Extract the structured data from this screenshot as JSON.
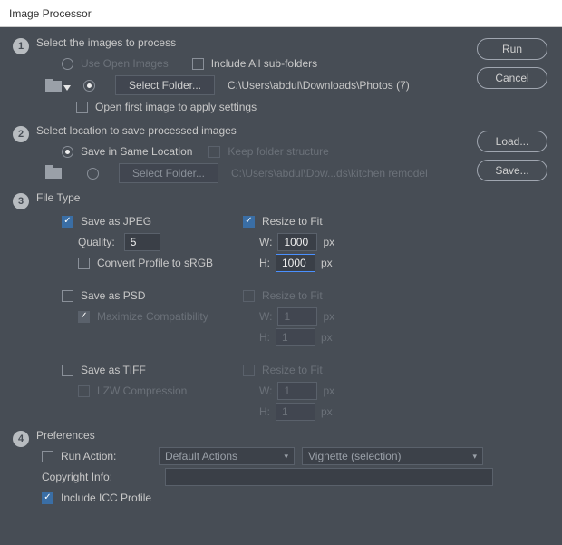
{
  "title": "Image Processor",
  "buttons": {
    "run": "Run",
    "cancel": "Cancel",
    "load": "Load...",
    "save": "Save..."
  },
  "step1": {
    "heading": "Select the images to process",
    "use_open": "Use Open Images",
    "include_sub": "Include All sub-folders",
    "select_folder": "Select Folder...",
    "path": "C:\\Users\\abdul\\Downloads\\Photos (7)",
    "open_first": "Open first image to apply settings"
  },
  "step2": {
    "heading": "Select location to save processed images",
    "same_loc": "Save in Same Location",
    "keep_struct": "Keep folder structure",
    "select_folder": "Select Folder...",
    "path": "C:\\Users\\abdul\\Dow...ds\\kitchen remodel"
  },
  "step3": {
    "heading": "File Type",
    "jpeg": {
      "save": "Save as JPEG",
      "quality_label": "Quality:",
      "quality": "5",
      "convert": "Convert Profile to sRGB",
      "resize": "Resize to Fit",
      "w_label": "W:",
      "w": "1000",
      "h_label": "H:",
      "h": "1000",
      "px": "px"
    },
    "psd": {
      "save": "Save as PSD",
      "max": "Maximize Compatibility",
      "resize": "Resize to Fit",
      "w_label": "W:",
      "w": "1",
      "h_label": "H:",
      "h": "1",
      "px": "px"
    },
    "tiff": {
      "save": "Save as TIFF",
      "lzw": "LZW Compression",
      "resize": "Resize to Fit",
      "w_label": "W:",
      "w": "1",
      "h_label": "H:",
      "h": "1",
      "px": "px"
    }
  },
  "step4": {
    "heading": "Preferences",
    "run_action": "Run Action:",
    "action_set": "Default Actions",
    "action": "Vignette (selection)",
    "copyright": "Copyright Info:",
    "icc": "Include ICC Profile"
  }
}
